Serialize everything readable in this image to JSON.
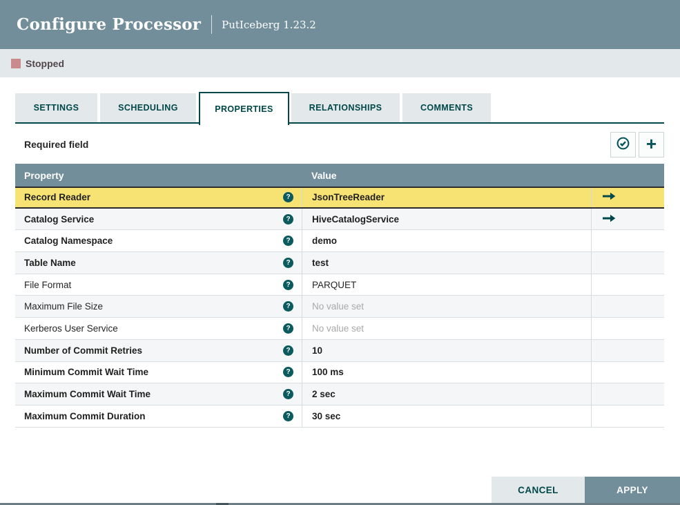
{
  "header": {
    "title": "Configure Processor",
    "subtitle": "PutIceberg 1.23.2"
  },
  "status": {
    "label": "Stopped"
  },
  "tabs": [
    {
      "label": "SETTINGS",
      "active": false
    },
    {
      "label": "SCHEDULING",
      "active": false
    },
    {
      "label": "PROPERTIES",
      "active": true
    },
    {
      "label": "RELATIONSHIPS",
      "active": false
    },
    {
      "label": "COMMENTS",
      "active": false
    }
  ],
  "properties_panel": {
    "required_label": "Required field"
  },
  "icons": {
    "help": "?",
    "plus": "+",
    "check": "check-circle",
    "arrow": "go-to-arrow"
  },
  "table": {
    "columns": {
      "property": "Property",
      "value": "Value"
    },
    "rows": [
      {
        "property": "Record Reader",
        "value": "JsonTreeReader"
      },
      {
        "property": "Catalog Service",
        "value": "HiveCatalogService"
      },
      {
        "property": "Catalog Namespace",
        "value": "demo"
      },
      {
        "property": "Table Name",
        "value": "test"
      },
      {
        "property": "File Format",
        "value": "PARQUET"
      },
      {
        "property": "Maximum File Size",
        "value": "No value set"
      },
      {
        "property": "Kerberos User Service",
        "value": "No value set"
      },
      {
        "property": "Number of Commit Retries",
        "value": "10"
      },
      {
        "property": "Minimum Commit Wait Time",
        "value": "100 ms"
      },
      {
        "property": "Maximum Commit Wait Time",
        "value": "2 sec"
      },
      {
        "property": "Maximum Commit Duration",
        "value": "30 sec"
      }
    ]
  },
  "footer": {
    "cancel_label": "CANCEL",
    "apply_label": "APPLY"
  },
  "colors": {
    "accent": "#728e9b",
    "tab_text": "#004849",
    "highlight_row": "#f7e373",
    "stopped": "#ca8b8e",
    "status_bar_bg": "#e3e8eb"
  }
}
